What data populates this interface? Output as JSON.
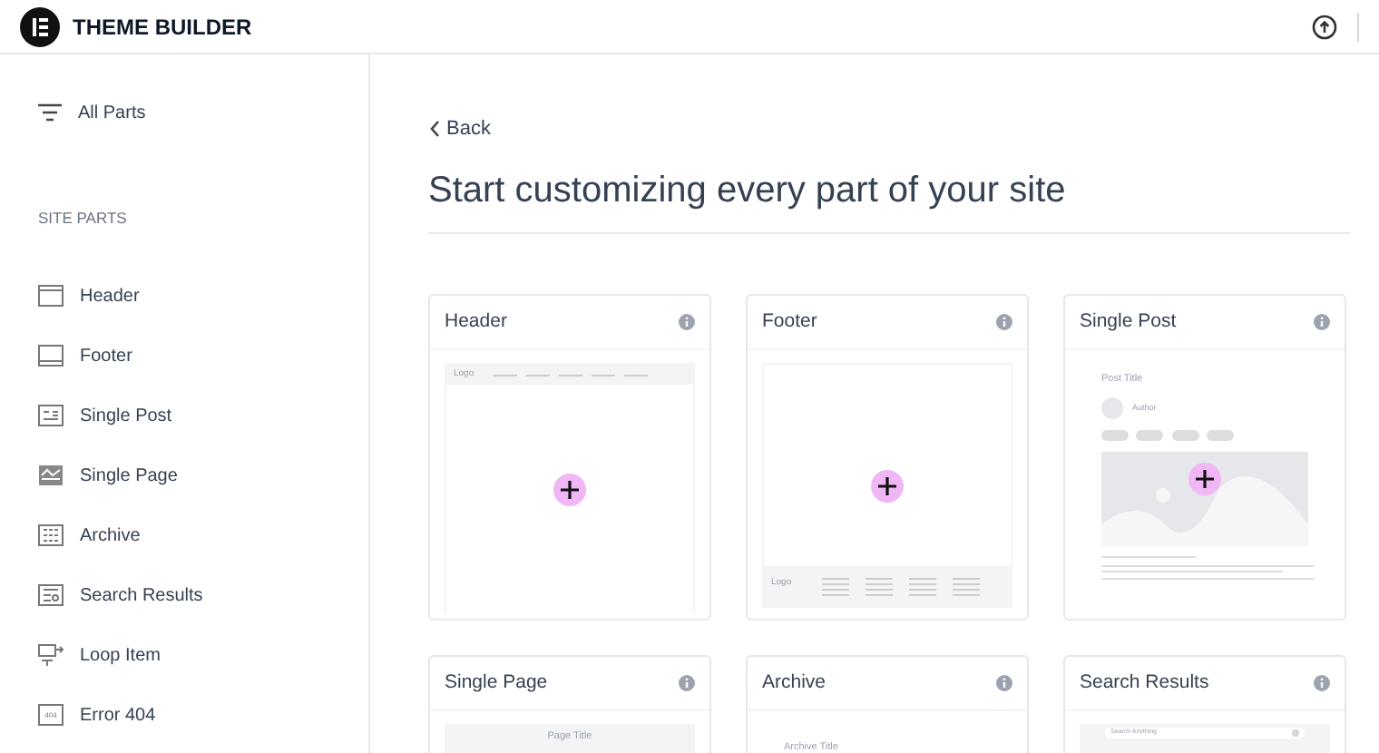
{
  "app_bar": {
    "title": "THEME BUILDER"
  },
  "sidebar": {
    "all_parts": "All Parts",
    "section_title": "SITE PARTS",
    "items": [
      {
        "label": "Header",
        "kind": "header"
      },
      {
        "label": "Footer",
        "kind": "footer"
      },
      {
        "label": "Single Post",
        "kind": "single_post"
      },
      {
        "label": "Single Page",
        "kind": "single_page"
      },
      {
        "label": "Archive",
        "kind": "archive"
      },
      {
        "label": "Search Results",
        "kind": "search_results"
      },
      {
        "label": "Loop Item",
        "kind": "loop_item"
      },
      {
        "label": "Error 404",
        "kind": "error_404",
        "icon_text": "404"
      }
    ]
  },
  "main": {
    "back": "Back",
    "title": "Start customizing every part of your site",
    "cards": [
      {
        "title": "Header",
        "kind": "header",
        "preview_text": [
          "Logo"
        ]
      },
      {
        "title": "Footer",
        "kind": "footer",
        "preview_text": [
          "Logo"
        ]
      },
      {
        "title": "Single Post",
        "kind": "single_post",
        "preview_text": [
          "Post Title",
          "Author"
        ]
      },
      {
        "title": "Single Page",
        "kind": "single_page",
        "preview_text": [
          "Page Title"
        ]
      },
      {
        "title": "Archive",
        "kind": "archive",
        "preview_text": [
          "Archive Title"
        ]
      },
      {
        "title": "Search Results",
        "kind": "search_results",
        "preview_text": [
          "Search Anything"
        ]
      }
    ]
  }
}
